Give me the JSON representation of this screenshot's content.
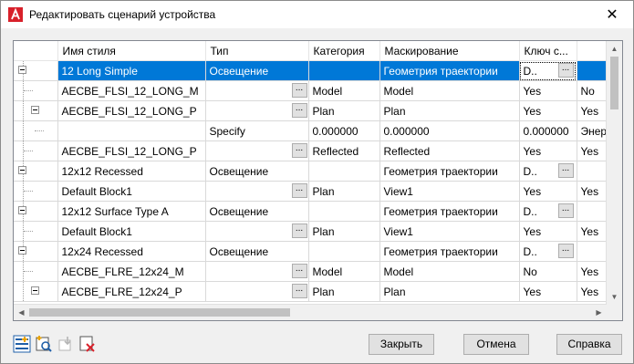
{
  "window": {
    "title": "Редактировать сценарий устройства",
    "close_glyph": "✕"
  },
  "columns": [
    "",
    "Имя стиля",
    "Тип",
    "Категория",
    "Маскирование",
    "Ключ с...",
    ""
  ],
  "rows": [
    {
      "name": "12 Long Simple",
      "type": "Освещение",
      "category": "",
      "mask": "Геометрия траектории",
      "key": "D..",
      "extra": "",
      "btn_type": false,
      "btn_key": true,
      "selected": true
    },
    {
      "name": "AECBE_FLSI_12_LONG_M",
      "type": "",
      "category": "Model",
      "mask": "Model",
      "key": "Yes",
      "extra": "No",
      "btn_type": true,
      "btn_key": false
    },
    {
      "name": "AECBE_FLSI_12_LONG_P",
      "type": "",
      "category": "Plan",
      "mask": "Plan",
      "key": "Yes",
      "extra": "Yes",
      "btn_type": true,
      "btn_key": false
    },
    {
      "name": "",
      "type": "Specify",
      "category": "0.000000",
      "mask": "0.000000",
      "key": "0.000000",
      "extra": "Энер",
      "btn_type": false,
      "btn_key": false
    },
    {
      "name": "AECBE_FLSI_12_LONG_P",
      "type": "",
      "category": "Reflected",
      "mask": "Reflected",
      "key": "Yes",
      "extra": "Yes",
      "btn_type": true,
      "btn_key": false
    },
    {
      "name": "12x12 Recessed",
      "type": "Освещение",
      "category": "",
      "mask": "Геометрия траектории",
      "key": "D..",
      "extra": "",
      "btn_type": false,
      "btn_key": true
    },
    {
      "name": "Default Block1",
      "type": "",
      "category": "Plan",
      "mask": "View1",
      "key": "Yes",
      "extra": "Yes",
      "btn_type": true,
      "btn_key": false
    },
    {
      "name": "12x12 Surface Type A",
      "type": "Освещение",
      "category": "",
      "mask": "Геометрия траектории",
      "key": "D..",
      "extra": "",
      "btn_type": false,
      "btn_key": true
    },
    {
      "name": "Default Block1",
      "type": "",
      "category": "Plan",
      "mask": "View1",
      "key": "Yes",
      "extra": "Yes",
      "btn_type": true,
      "btn_key": false
    },
    {
      "name": "12x24 Recessed",
      "type": "Освещение",
      "category": "",
      "mask": "Геометрия траектории",
      "key": "D..",
      "extra": "",
      "btn_type": false,
      "btn_key": true
    },
    {
      "name": "AECBE_FLRE_12x24_M",
      "type": "",
      "category": "Model",
      "mask": "Model",
      "key": "No",
      "extra": "Yes",
      "btn_type": true,
      "btn_key": false
    },
    {
      "name": "AECBE_FLRE_12x24_P",
      "type": "",
      "category": "Plan",
      "mask": "Plan",
      "key": "Yes",
      "extra": "Yes",
      "btn_type": true,
      "btn_key": false
    }
  ],
  "ellipsis": "...",
  "toolbar": [
    "add-style-icon",
    "add-view-icon",
    "move-icon",
    "delete-icon"
  ],
  "buttons": {
    "close": "Закрыть",
    "cancel": "Отмена",
    "help": "Справка"
  },
  "colors": {
    "selection": "#0078d7",
    "brand": "#d8202a"
  }
}
